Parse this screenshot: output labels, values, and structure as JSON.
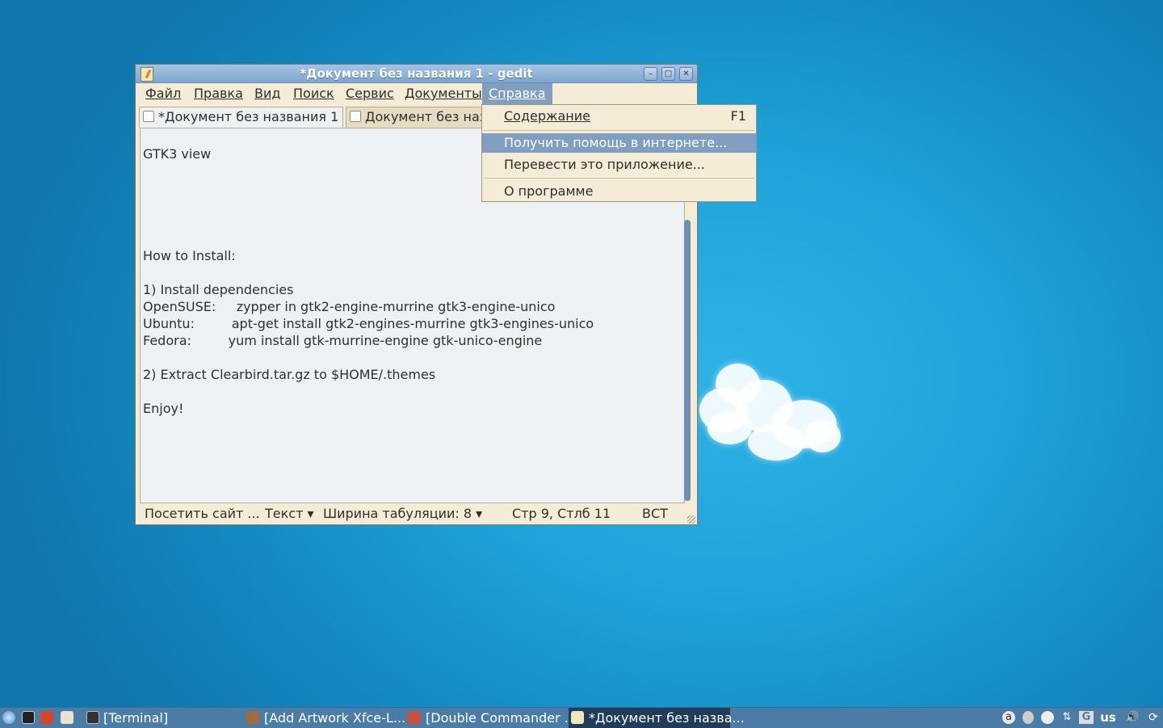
{
  "colors": {
    "desktop": "#1ea2d9",
    "menu_highlight": "#7f9ec0",
    "taskbar": "#4a7ca6"
  },
  "window": {
    "title": "*Документ без названия 1 - gedit",
    "controls": {
      "minimize": "–",
      "maximize": "□",
      "close": "✕"
    }
  },
  "menubar": {
    "file": "Файл",
    "edit": "Правка",
    "view": "Вид",
    "search": "Поиск",
    "tools": "Сервис",
    "documents": "Документы",
    "help": "Справка"
  },
  "tabs": [
    {
      "label": "*Документ без названия 1",
      "close": "✖"
    },
    {
      "label": "Документ без назв"
    }
  ],
  "editor": {
    "lines": [
      "GTK3 view ",
      "How to Install:",
      "1) Install dependencies",
      "OpenSUSE:     zypper in gtk2-engine-murrine gtk3-engine-unico",
      "Ubuntu:         apt-get install gtk2-engines-murrine gtk3-engines-unico",
      "Fedora:         yum install gtk-murrine-engine gtk-unico-engine",
      "2) Extract Clearbird.tar.gz to $HOME/.themes",
      "Enjoy!"
    ]
  },
  "help_menu": {
    "contents": "Содержание",
    "contents_shortcut": "F1",
    "online_help": "Получить помощь в интернете...",
    "translate": "Перевести это приложение...",
    "about": "О программе"
  },
  "statusbar": {
    "visit": "Посетить сайт ...",
    "lang": "Текст ▾",
    "tabwidth": "Ширина табуляции:  8  ▾",
    "position": "Стр 9, Стлб 11",
    "mode": "ВСТ"
  },
  "taskbar": {
    "terminal": "[Terminal]",
    "add_artwork": "[Add  Artwork Xfce-L...",
    "double_commander": "[Double Commander ...",
    "gedit": "*Документ без назва...",
    "keyboard_layout": "us"
  }
}
